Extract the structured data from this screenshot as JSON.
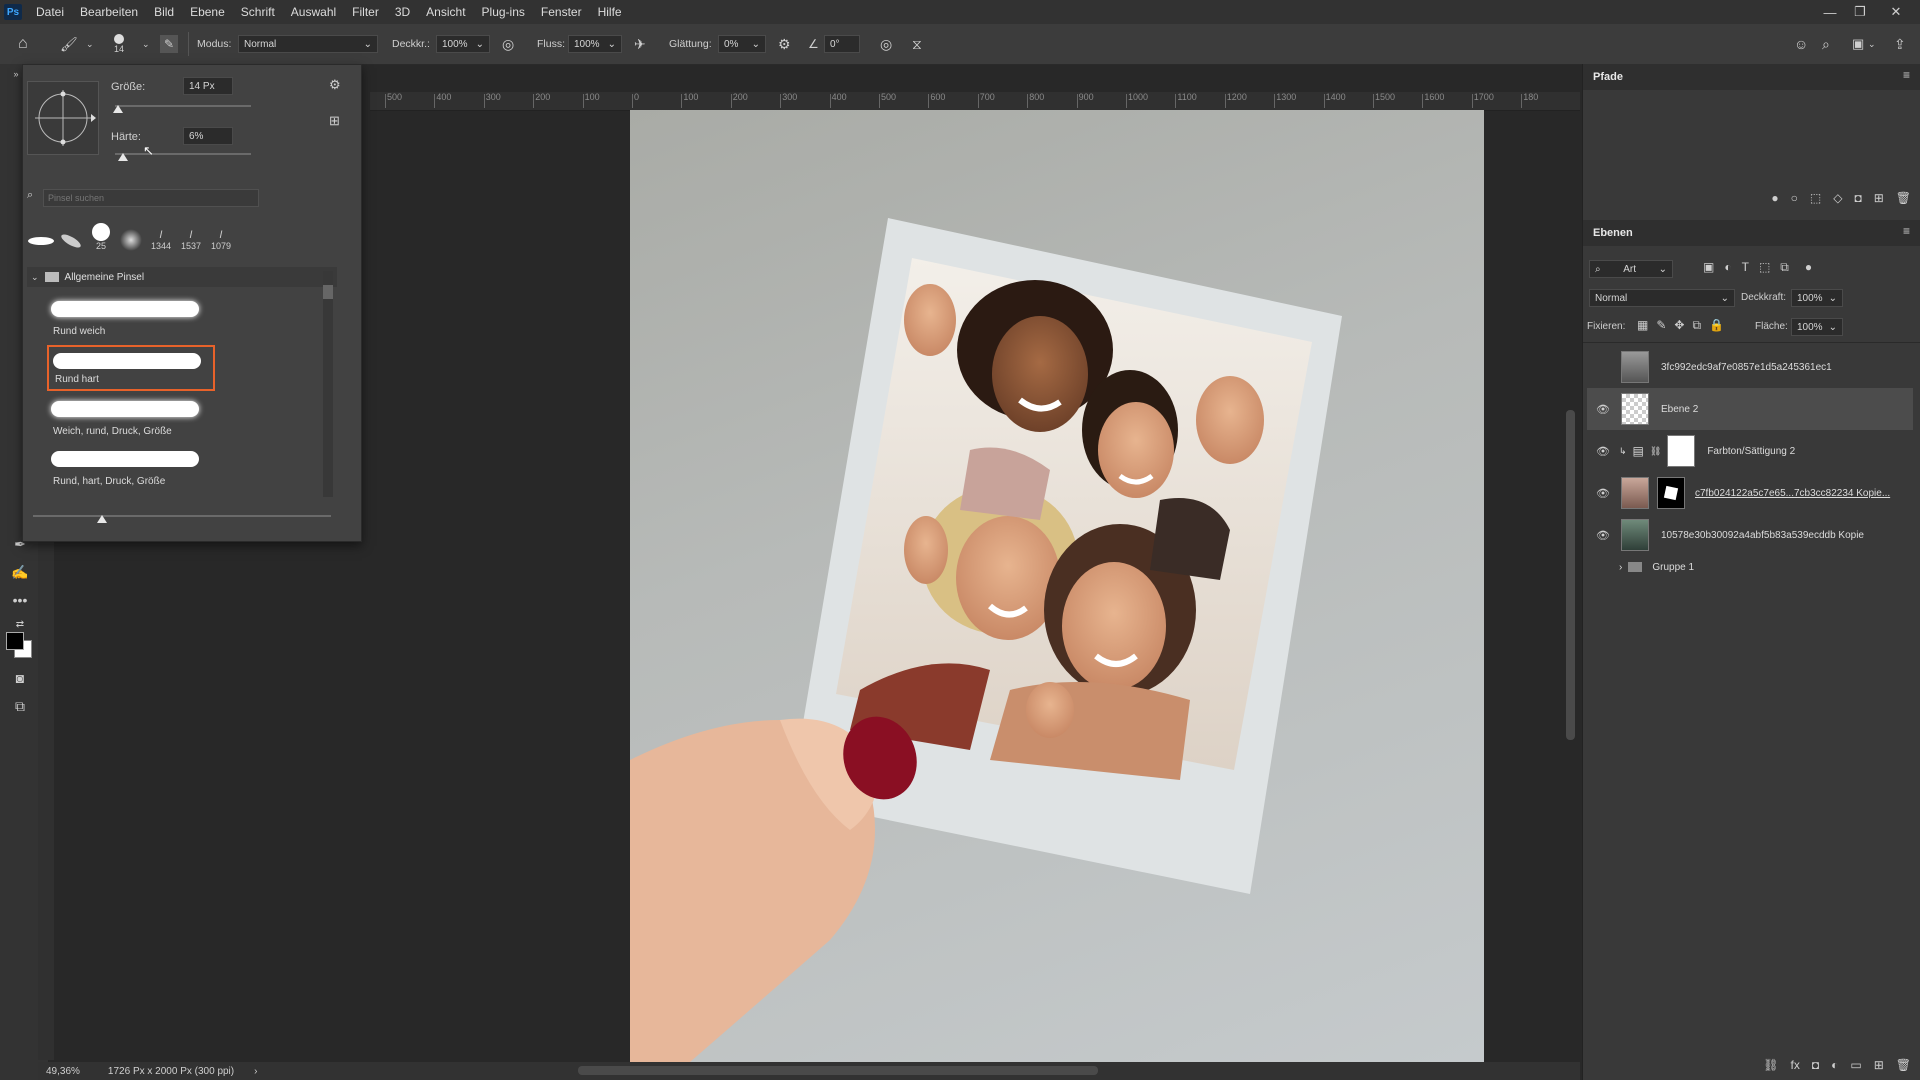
{
  "menu": {
    "logo": "Ps",
    "items": [
      "Datei",
      "Bearbeiten",
      "Bild",
      "Ebene",
      "Schrift",
      "Auswahl",
      "Filter",
      "3D",
      "Ansicht",
      "Plug-ins",
      "Fenster",
      "Hilfe"
    ]
  },
  "options": {
    "brush_size": "14",
    "modus_label": "Modus:",
    "modus_value": "Normal",
    "deckkr_label": "Deckkr.:",
    "deckkr_value": "100%",
    "fluss_label": "Fluss:",
    "fluss_value": "100%",
    "glaettung_label": "Glättung:",
    "glaettung_value": "0%",
    "angle_value": "0°"
  },
  "brush_panel": {
    "size_label": "Größe:",
    "size_value": "14 Px",
    "size_level": 0.02,
    "hardness_label": "Härte:",
    "hardness_value": "6%",
    "hardness_level": 0.06,
    "search_placeholder": "Pinsel suchen",
    "presets": [
      "",
      "",
      "25",
      "",
      "1344",
      "1537",
      "1079"
    ],
    "folder": "Allgemeine Pinsel",
    "brushes": [
      "Rund weich",
      "Rund hart",
      "Weich, rund, Druck, Größe",
      "Rund, hart, Druck, Größe"
    ],
    "selected_brush": 1
  },
  "ruler_ticks": [
    "500",
    "400",
    "300",
    "200",
    "100",
    "0",
    "100",
    "200",
    "300",
    "400",
    "500",
    "600",
    "700",
    "800",
    "900",
    "1000",
    "1100",
    "1200",
    "1300",
    "1400",
    "1500",
    "1600",
    "1700",
    "180"
  ],
  "status": {
    "zoom": "49,36%",
    "doc_info": "1726 Px x 2000 Px (300 ppi)"
  },
  "paths_panel": {
    "title": "Pfade"
  },
  "layers_panel": {
    "title": "Ebenen",
    "filter_value": "Art",
    "blend_mode": "Normal",
    "opacity_label": "Deckkraft:",
    "opacity_value": "100%",
    "lock_label": "Fixieren:",
    "fill_label": "Fläche:",
    "fill_value": "100%",
    "layers": [
      {
        "name": "3fc992edc9af7e0857e1d5a245361ec1",
        "visible": false
      },
      {
        "name": "Ebene 2",
        "visible": true
      },
      {
        "name": "Farbton/Sättigung 2",
        "visible": true
      },
      {
        "name": "c7fb024122a5c7e65...7cb3cc82234 Kopie...",
        "visible": true
      },
      {
        "name": "10578e30b30092a4abf5b83a539ecddb Kopie",
        "visible": true
      },
      {
        "name": "Gruppe 1",
        "visible": false
      }
    ]
  },
  "colors": {
    "accent_selected": "#e8622a",
    "layer_selected_bg": "#4c4c4c",
    "nail": "#8a0f23"
  }
}
